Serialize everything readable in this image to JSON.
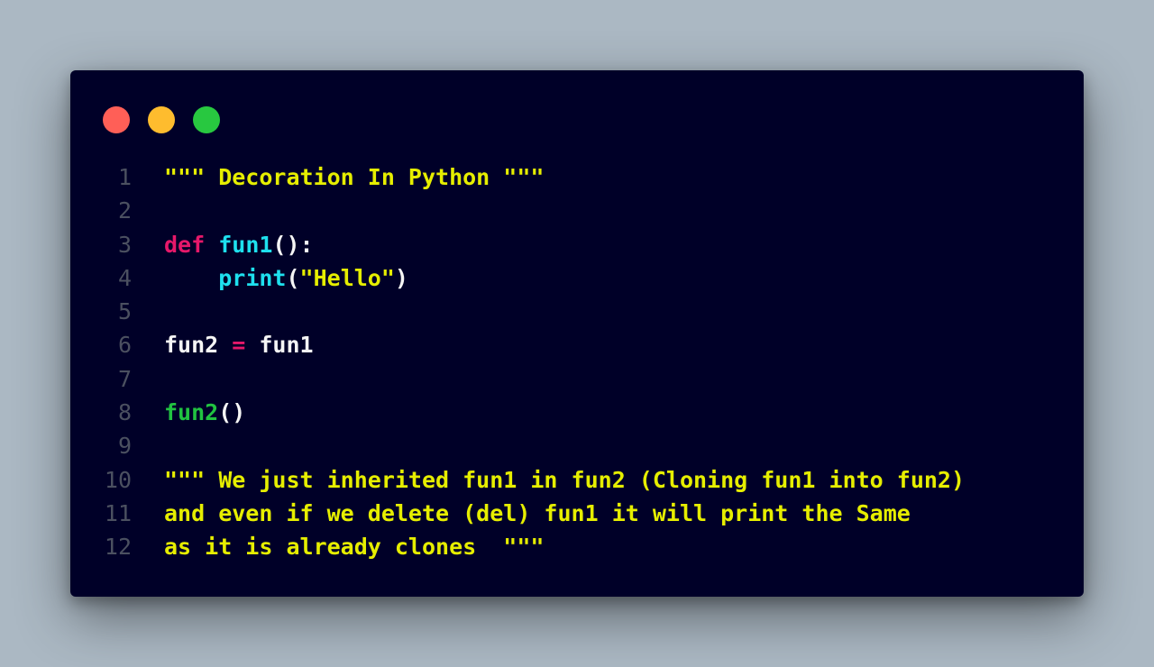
{
  "colors": {
    "background": "#abb8c3",
    "window_bg": "#000028",
    "dot_close": "#ff5f57",
    "dot_minimize": "#febc2e",
    "dot_maximize": "#28c840",
    "line_number": "#4b5060",
    "string": "#e6ee00",
    "keyword": "#e6186a",
    "function": "#1ee0ee",
    "call": "#21c341",
    "plain": "#f5f5f5",
    "operator": "#e6186a"
  },
  "window_controls": [
    "close",
    "minimize",
    "maximize"
  ],
  "code_lines": [
    {
      "number": "1",
      "tokens": [
        {
          "text": "\"\"\" Decoration In Python \"\"\"",
          "type": "string"
        }
      ]
    },
    {
      "number": "2",
      "tokens": []
    },
    {
      "number": "3",
      "tokens": [
        {
          "text": "def",
          "type": "keyword"
        },
        {
          "text": " ",
          "type": "plain"
        },
        {
          "text": "fun1",
          "type": "function"
        },
        {
          "text": "():",
          "type": "plain"
        }
      ]
    },
    {
      "number": "4",
      "tokens": [
        {
          "text": "    ",
          "type": "plain"
        },
        {
          "text": "print",
          "type": "function"
        },
        {
          "text": "(",
          "type": "plain"
        },
        {
          "text": "\"Hello\"",
          "type": "string"
        },
        {
          "text": ")",
          "type": "plain"
        }
      ]
    },
    {
      "number": "5",
      "tokens": []
    },
    {
      "number": "6",
      "tokens": [
        {
          "text": "fun2 ",
          "type": "plain"
        },
        {
          "text": "=",
          "type": "operator"
        },
        {
          "text": " fun1",
          "type": "plain"
        }
      ]
    },
    {
      "number": "7",
      "tokens": []
    },
    {
      "number": "8",
      "tokens": [
        {
          "text": "fun2",
          "type": "call"
        },
        {
          "text": "()",
          "type": "plain"
        }
      ]
    },
    {
      "number": "9",
      "tokens": []
    },
    {
      "number": "10",
      "tokens": [
        {
          "text": "\"\"\" We just inherited fun1 in fun2 (Cloning fun1 into fun2)",
          "type": "string"
        }
      ]
    },
    {
      "number": "11",
      "tokens": [
        {
          "text": "and even if we delete (del) fun1 it will print the Same",
          "type": "string"
        }
      ]
    },
    {
      "number": "12",
      "tokens": [
        {
          "text": "as it is already clones  \"\"\"",
          "type": "string"
        }
      ]
    }
  ]
}
